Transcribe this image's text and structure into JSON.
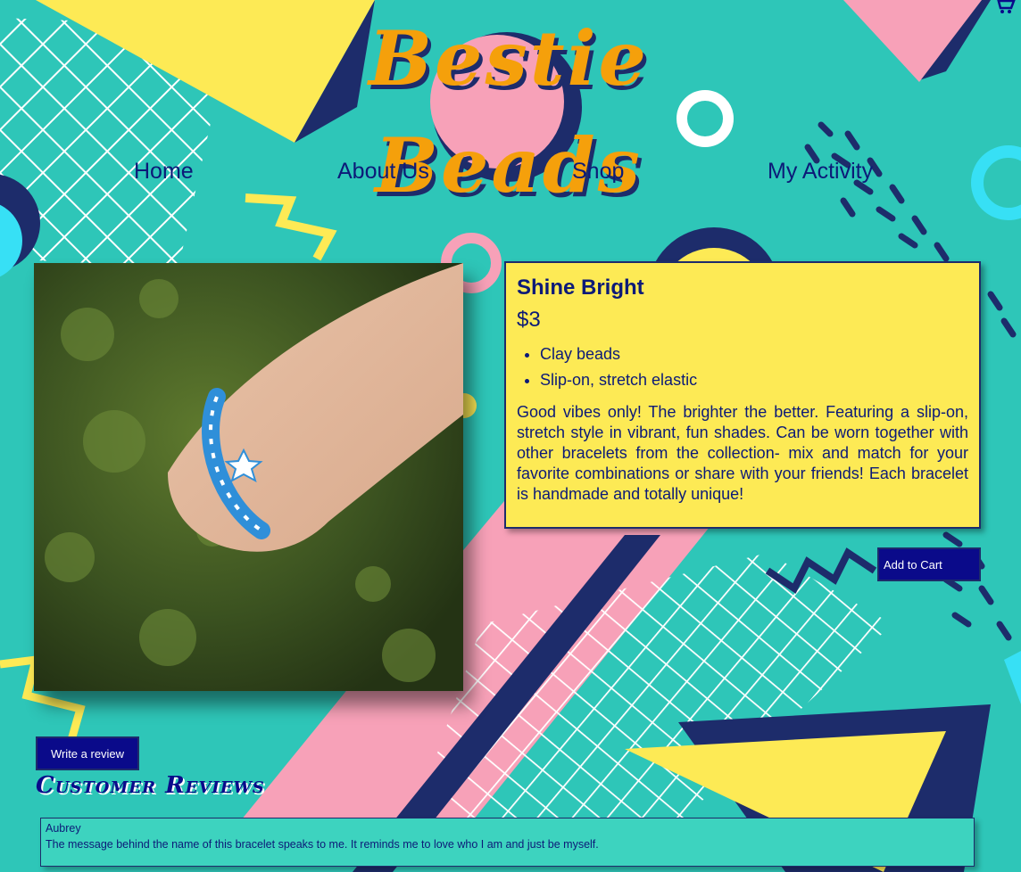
{
  "brand": {
    "logo_text": "Bestie Beads"
  },
  "nav": {
    "items": [
      {
        "label": "Home"
      },
      {
        "label": "About Us"
      },
      {
        "label": "Shop"
      },
      {
        "label": "My Activity"
      }
    ]
  },
  "product": {
    "name": "Shine Bright",
    "price": "$3",
    "features": [
      "Clay beads",
      "Slip-on, stretch elastic"
    ],
    "description": "Good vibes only! The brighter the better. Featuring a slip-on, stretch style in vibrant, fun shades. Can be worn together with other bracelets from the collection- mix and match for your favorite combinations or share with your friends! Each bracelet is handmade and totally unique!",
    "add_to_cart_label": "Add to Cart"
  },
  "reviews": {
    "write_review_label": "Write a review",
    "title": "Customer Reviews",
    "items": [
      {
        "author": "Aubrey",
        "text": "The message behind the name of this bracelet speaks to me. It reminds me to love who I am and just be myself."
      }
    ]
  },
  "icons": {
    "cart": "shopping-cart-icon"
  },
  "colors": {
    "background": "#2ec6b8",
    "accent_yellow": "#fdea55",
    "accent_pink": "#f7a1b8",
    "navy": "#1d2c6b",
    "link_blue": "#0c1a78",
    "button_bg": "#0a0a8a",
    "logo_orange": "#f5a00b"
  }
}
